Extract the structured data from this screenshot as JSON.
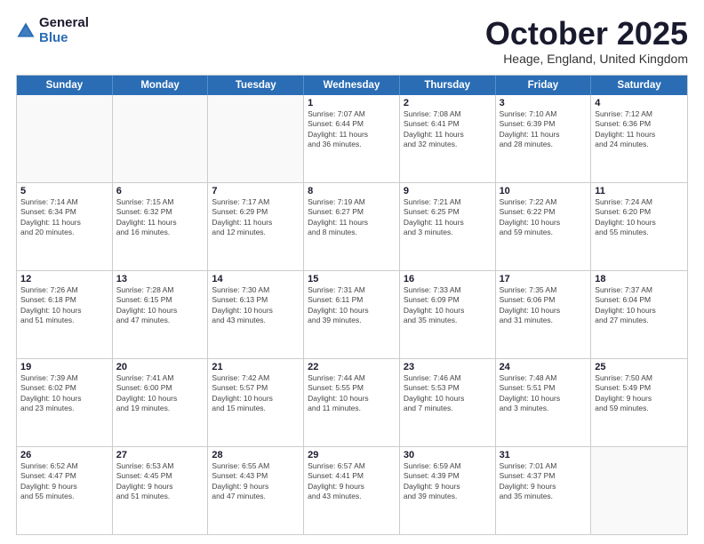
{
  "logo": {
    "general": "General",
    "blue": "Blue"
  },
  "title": "October 2025",
  "location": "Heage, England, United Kingdom",
  "days_of_week": [
    "Sunday",
    "Monday",
    "Tuesday",
    "Wednesday",
    "Thursday",
    "Friday",
    "Saturday"
  ],
  "weeks": [
    [
      {
        "day": "",
        "info": ""
      },
      {
        "day": "",
        "info": ""
      },
      {
        "day": "",
        "info": ""
      },
      {
        "day": "1",
        "info": "Sunrise: 7:07 AM\nSunset: 6:44 PM\nDaylight: 11 hours\nand 36 minutes."
      },
      {
        "day": "2",
        "info": "Sunrise: 7:08 AM\nSunset: 6:41 PM\nDaylight: 11 hours\nand 32 minutes."
      },
      {
        "day": "3",
        "info": "Sunrise: 7:10 AM\nSunset: 6:39 PM\nDaylight: 11 hours\nand 28 minutes."
      },
      {
        "day": "4",
        "info": "Sunrise: 7:12 AM\nSunset: 6:36 PM\nDaylight: 11 hours\nand 24 minutes."
      }
    ],
    [
      {
        "day": "5",
        "info": "Sunrise: 7:14 AM\nSunset: 6:34 PM\nDaylight: 11 hours\nand 20 minutes."
      },
      {
        "day": "6",
        "info": "Sunrise: 7:15 AM\nSunset: 6:32 PM\nDaylight: 11 hours\nand 16 minutes."
      },
      {
        "day": "7",
        "info": "Sunrise: 7:17 AM\nSunset: 6:29 PM\nDaylight: 11 hours\nand 12 minutes."
      },
      {
        "day": "8",
        "info": "Sunrise: 7:19 AM\nSunset: 6:27 PM\nDaylight: 11 hours\nand 8 minutes."
      },
      {
        "day": "9",
        "info": "Sunrise: 7:21 AM\nSunset: 6:25 PM\nDaylight: 11 hours\nand 3 minutes."
      },
      {
        "day": "10",
        "info": "Sunrise: 7:22 AM\nSunset: 6:22 PM\nDaylight: 10 hours\nand 59 minutes."
      },
      {
        "day": "11",
        "info": "Sunrise: 7:24 AM\nSunset: 6:20 PM\nDaylight: 10 hours\nand 55 minutes."
      }
    ],
    [
      {
        "day": "12",
        "info": "Sunrise: 7:26 AM\nSunset: 6:18 PM\nDaylight: 10 hours\nand 51 minutes."
      },
      {
        "day": "13",
        "info": "Sunrise: 7:28 AM\nSunset: 6:15 PM\nDaylight: 10 hours\nand 47 minutes."
      },
      {
        "day": "14",
        "info": "Sunrise: 7:30 AM\nSunset: 6:13 PM\nDaylight: 10 hours\nand 43 minutes."
      },
      {
        "day": "15",
        "info": "Sunrise: 7:31 AM\nSunset: 6:11 PM\nDaylight: 10 hours\nand 39 minutes."
      },
      {
        "day": "16",
        "info": "Sunrise: 7:33 AM\nSunset: 6:09 PM\nDaylight: 10 hours\nand 35 minutes."
      },
      {
        "day": "17",
        "info": "Sunrise: 7:35 AM\nSunset: 6:06 PM\nDaylight: 10 hours\nand 31 minutes."
      },
      {
        "day": "18",
        "info": "Sunrise: 7:37 AM\nSunset: 6:04 PM\nDaylight: 10 hours\nand 27 minutes."
      }
    ],
    [
      {
        "day": "19",
        "info": "Sunrise: 7:39 AM\nSunset: 6:02 PM\nDaylight: 10 hours\nand 23 minutes."
      },
      {
        "day": "20",
        "info": "Sunrise: 7:41 AM\nSunset: 6:00 PM\nDaylight: 10 hours\nand 19 minutes."
      },
      {
        "day": "21",
        "info": "Sunrise: 7:42 AM\nSunset: 5:57 PM\nDaylight: 10 hours\nand 15 minutes."
      },
      {
        "day": "22",
        "info": "Sunrise: 7:44 AM\nSunset: 5:55 PM\nDaylight: 10 hours\nand 11 minutes."
      },
      {
        "day": "23",
        "info": "Sunrise: 7:46 AM\nSunset: 5:53 PM\nDaylight: 10 hours\nand 7 minutes."
      },
      {
        "day": "24",
        "info": "Sunrise: 7:48 AM\nSunset: 5:51 PM\nDaylight: 10 hours\nand 3 minutes."
      },
      {
        "day": "25",
        "info": "Sunrise: 7:50 AM\nSunset: 5:49 PM\nDaylight: 9 hours\nand 59 minutes."
      }
    ],
    [
      {
        "day": "26",
        "info": "Sunrise: 6:52 AM\nSunset: 4:47 PM\nDaylight: 9 hours\nand 55 minutes."
      },
      {
        "day": "27",
        "info": "Sunrise: 6:53 AM\nSunset: 4:45 PM\nDaylight: 9 hours\nand 51 minutes."
      },
      {
        "day": "28",
        "info": "Sunrise: 6:55 AM\nSunset: 4:43 PM\nDaylight: 9 hours\nand 47 minutes."
      },
      {
        "day": "29",
        "info": "Sunrise: 6:57 AM\nSunset: 4:41 PM\nDaylight: 9 hours\nand 43 minutes."
      },
      {
        "day": "30",
        "info": "Sunrise: 6:59 AM\nSunset: 4:39 PM\nDaylight: 9 hours\nand 39 minutes."
      },
      {
        "day": "31",
        "info": "Sunrise: 7:01 AM\nSunset: 4:37 PM\nDaylight: 9 hours\nand 35 minutes."
      },
      {
        "day": "",
        "info": ""
      }
    ]
  ]
}
